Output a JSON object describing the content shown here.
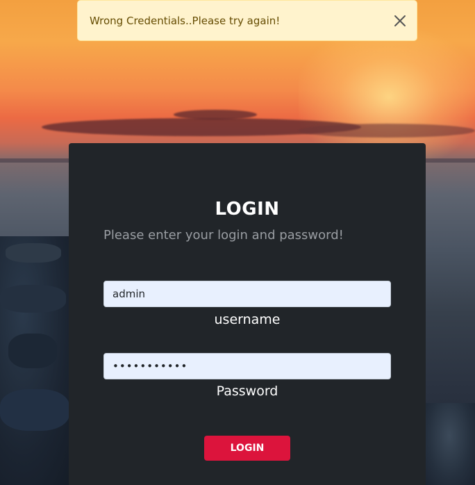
{
  "alert": {
    "message": "Wrong Credentials..Please try again!",
    "close_icon": "close-icon",
    "colors": {
      "background": "#fff3cd",
      "text": "#664d03"
    }
  },
  "login": {
    "title": "LOGIN",
    "subtitle": "Please enter your login and password!",
    "username": {
      "value": "admin",
      "label": "username"
    },
    "password": {
      "value": "•••••••••••",
      "label": "Password"
    },
    "submit_label": "LOGIN",
    "colors": {
      "card": "#212529",
      "button": "#dc143c"
    }
  }
}
